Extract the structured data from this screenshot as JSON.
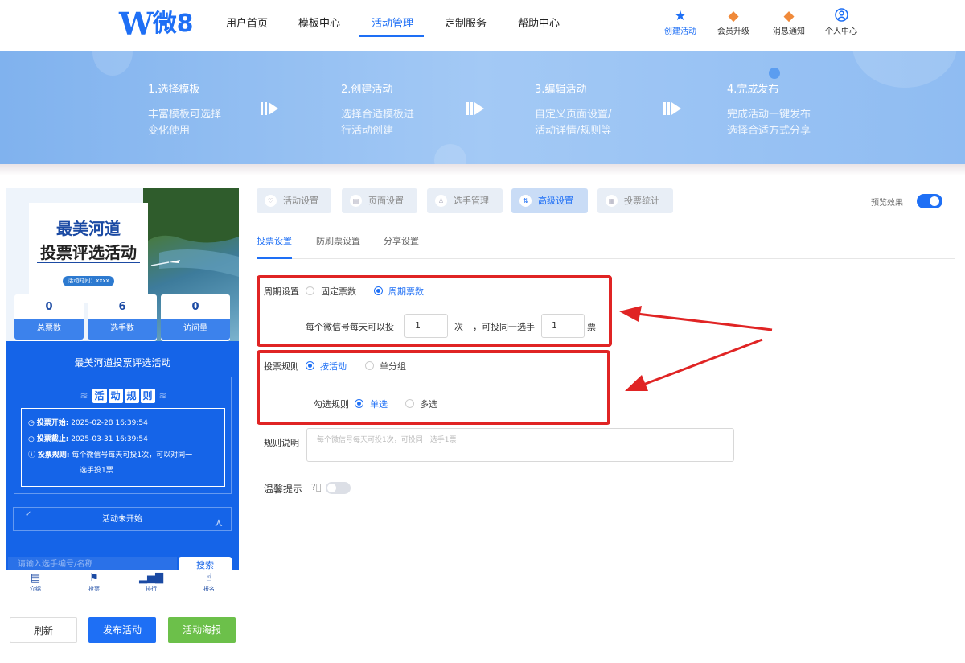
{
  "header": {
    "logo_mark": "W",
    "logo_text": "微8",
    "nav": [
      "用户首页",
      "模板中心",
      "活动管理",
      "定制服务",
      "帮助中心"
    ],
    "nav_active_index": 2,
    "actions": [
      {
        "label": "创建活动",
        "icon": "sparkle-star-icon"
      },
      {
        "label": "会员升级",
        "icon": "vip-badge-icon"
      },
      {
        "label": "消息通知",
        "icon": "notification-badge-icon"
      },
      {
        "label": "个人中心",
        "icon": "user-icon"
      }
    ]
  },
  "steps": [
    {
      "title": "1.选择模板",
      "desc1": "丰富模板可选择",
      "desc2": "变化使用"
    },
    {
      "title": "2.创建活动",
      "desc1": "选择合适模板进",
      "desc2": "行活动创建"
    },
    {
      "title": "3.编辑活动",
      "desc1": "自定义页面设置/",
      "desc2": "活动详情/规则等"
    },
    {
      "title": "4.完成发布",
      "desc1": "完成活动一键发布",
      "desc2": "选择合适方式分享"
    }
  ],
  "preview": {
    "title_line1": "最美河道",
    "title_line2": "投票评选活动",
    "date_tag": "活动时间：xxxx",
    "stats": [
      {
        "value": "0",
        "label": "总票数"
      },
      {
        "value": "6",
        "label": "选手数"
      },
      {
        "value": "0",
        "label": "访问量"
      }
    ],
    "activity_name": "最美河道投票评选活动",
    "rules_chars": [
      "活",
      "动",
      "规",
      "则"
    ],
    "rules": {
      "start_label": "投票开始:",
      "start_value": "2025-02-28 16:39:54",
      "end_label": "投票截止:",
      "end_value": "2025-03-31 16:39:54",
      "rule_label": "投票规则:",
      "rule_value_1": "每个微信号每天可投1次，可以对同一",
      "rule_value_2": "选手投1票"
    },
    "status": "活动未开始",
    "search_placeholder": "请输入选手编号/名称",
    "search_button": "搜索",
    "tabbar": [
      {
        "label": "介绍",
        "icon": "document-icon"
      },
      {
        "label": "投票",
        "icon": "flag-icon"
      },
      {
        "label": "排行",
        "icon": "bar-chart-icon"
      },
      {
        "label": "报名",
        "icon": "hand-tap-icon"
      }
    ]
  },
  "bottom_buttons": {
    "refresh": "刷新",
    "publish": "发布活动",
    "poster": "活动海报"
  },
  "tabs": [
    "活动设置",
    "页面设置",
    "选手管理",
    "高级设置",
    "投票统计"
  ],
  "tabs_active_index": 3,
  "preview_toggle_label": "预览效果",
  "subtabs": [
    "投票设置",
    "防刷票设置",
    "分享设置"
  ],
  "subtabs_active_index": 0,
  "form": {
    "cycle_label": "周期设置",
    "cycle_options": [
      "固定票数",
      "周期票数"
    ],
    "cycle_selected": 1,
    "daily_prefix": "每个微信号每天可以投",
    "daily_value": "1",
    "daily_unit": "次",
    "same_prefix": "，可投同一选手",
    "same_value": "1",
    "same_unit": "票",
    "rule_label": "投票规则",
    "rule_options": [
      "按活动",
      "单分组"
    ],
    "rule_selected": 0,
    "check_label": "勾选规则",
    "check_options": [
      "单选",
      "多选"
    ],
    "check_selected": 0,
    "desc_label": "规则说明",
    "desc_placeholder": "每个微信号每天可投1次，可投同一选手1票",
    "tip_label": "温馨提示"
  },
  "colors": {
    "accent": "#1e6ff5",
    "annotation": "#e02424",
    "publish": "#1e6ff5",
    "poster": "#6cc04a"
  }
}
